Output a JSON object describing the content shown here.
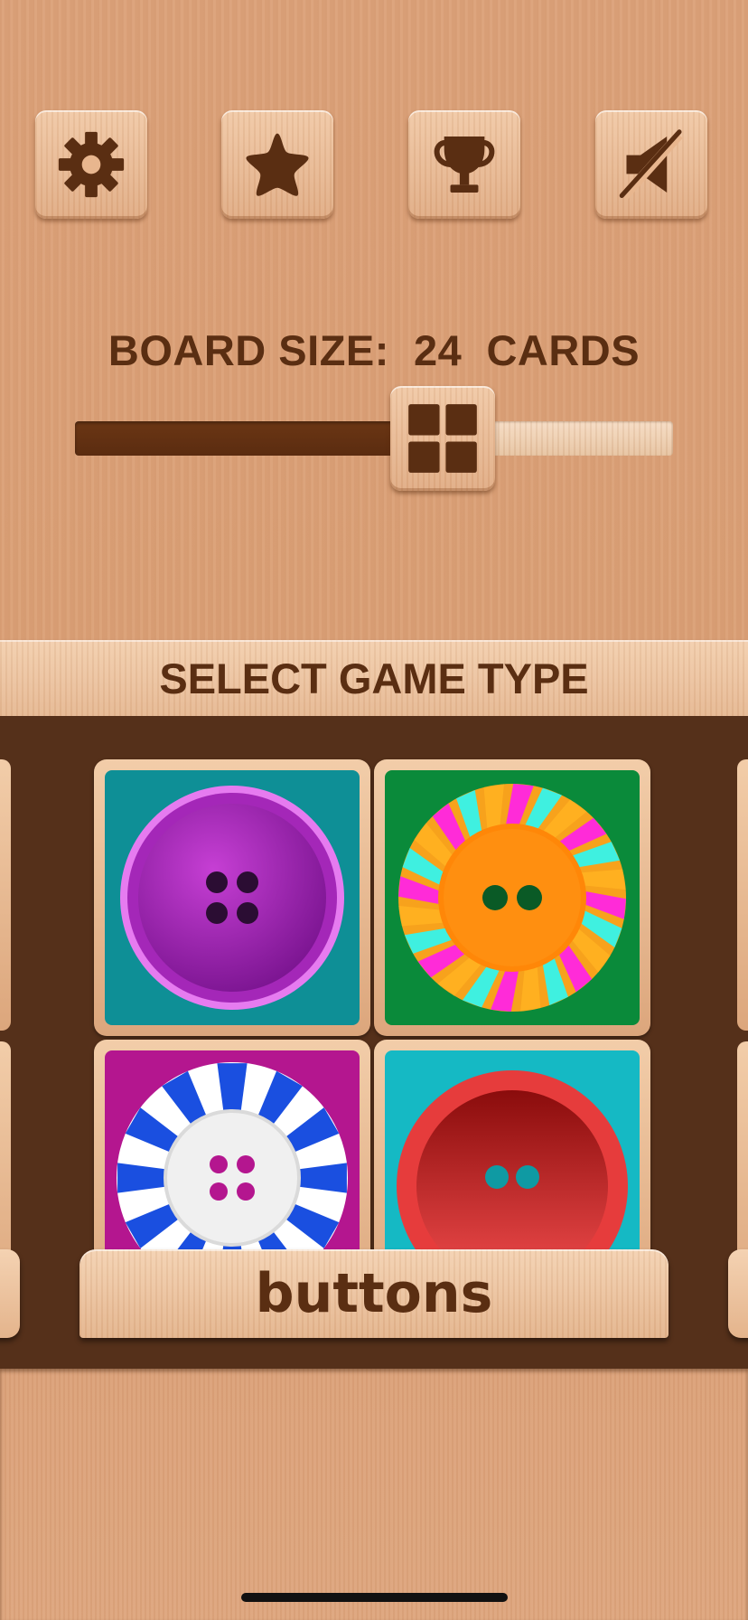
{
  "toolbar": {
    "buttons": [
      {
        "name": "settings",
        "icon": "gear-icon"
      },
      {
        "name": "favorites",
        "icon": "star-icon"
      },
      {
        "name": "leaderboard",
        "icon": "trophy-icon"
      },
      {
        "name": "sound",
        "icon": "speaker-muted-icon"
      }
    ]
  },
  "board": {
    "label_prefix": "BOARD SIZE:",
    "count": "24",
    "label_suffix": "CARDS",
    "slider_fraction": 0.615,
    "thumb_icon": "grid-four-icon"
  },
  "game_type": {
    "header": "SELECT GAME TYPE",
    "selected_name": "buttons",
    "preview_tiles": [
      {
        "bg": "#0e8f96",
        "button": "purple-button-icon"
      },
      {
        "bg": "#0a8a3a",
        "button": "striped-orange-button-icon"
      },
      {
        "bg": "#b4168f",
        "button": "striped-white-button-icon"
      },
      {
        "bg": "#15b9c4",
        "button": "red-button-icon"
      }
    ]
  },
  "colors": {
    "dark_wood": "#55301a",
    "text_brown": "#5a2e12"
  }
}
